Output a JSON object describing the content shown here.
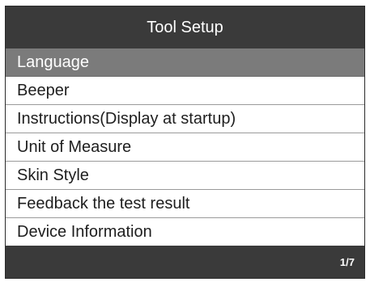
{
  "header": {
    "title": "Tool Setup"
  },
  "menu": {
    "selected_index": 0,
    "items": [
      {
        "label": "Language"
      },
      {
        "label": "Beeper"
      },
      {
        "label": "Instructions(Display at startup)"
      },
      {
        "label": "Unit of Measure"
      },
      {
        "label": "Skin Style"
      },
      {
        "label": "Feedback the test result"
      },
      {
        "label": "Device Information"
      }
    ]
  },
  "footer": {
    "page_indicator": "1/7"
  },
  "colors": {
    "bar_background": "#3a3a3a",
    "selected_background": "#7b7b7b",
    "divider": "#9a9a9a"
  }
}
